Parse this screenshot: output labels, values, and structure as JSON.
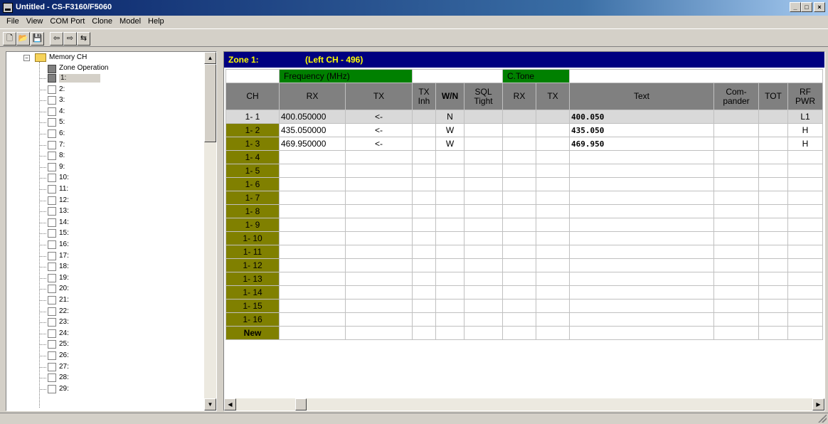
{
  "window": {
    "title": "Untitled - CS-F3160/F5060",
    "min": "_",
    "max": "□",
    "close": "×"
  },
  "menubar": [
    "File",
    "View",
    "COM Port",
    "Clone",
    "Model",
    "Help"
  ],
  "toolbar": [
    {
      "icon": "new-icon",
      "glyph": "🗋"
    },
    {
      "icon": "open-icon",
      "glyph": "📂"
    },
    {
      "icon": "save-icon",
      "glyph": "💾"
    },
    {
      "icon": "read-radio-icon",
      "glyph": "⇦"
    },
    {
      "icon": "write-radio-icon",
      "glyph": "⇨"
    },
    {
      "icon": "clone-icon",
      "glyph": "⇆"
    }
  ],
  "tree": {
    "root": "Memory CH",
    "zone_op": "Zone Operation",
    "items": [
      "1:",
      "2:",
      "3:",
      "4:",
      "5:",
      "6:",
      "7:",
      "8:",
      "9:",
      "10:",
      "11:",
      "12:",
      "13:",
      "14:",
      "15:",
      "16:",
      "17:",
      "18:",
      "19:",
      "20:",
      "21:",
      "22:",
      "23:",
      "24:",
      "25:",
      "26:",
      "27:",
      "28:",
      "29:"
    ]
  },
  "zone": {
    "label": "Zone 1:",
    "left": "(Left CH - 496)"
  },
  "groups": {
    "freq": "Frequency (MHz)",
    "ctone": "C.Tone"
  },
  "headers": {
    "ch": "CH",
    "rx": "RX",
    "tx": "TX",
    "txinh": "TX Inh",
    "wn": "W/N",
    "sql": "SQL Tight",
    "crx": "RX",
    "ctx": "TX",
    "text": "Text",
    "comp": "Com- pander",
    "tot": "TOT",
    "rf": "RF PWR"
  },
  "rows": [
    {
      "ch": "1- 1",
      "rx": "400.050000",
      "tx": "<-",
      "wn": "N",
      "text": "400.050",
      "rf": "L1"
    },
    {
      "ch": "1- 2",
      "rx": "435.050000",
      "tx": "<-",
      "wn": "W",
      "text": "435.050",
      "rf": "H"
    },
    {
      "ch": "1- 3",
      "rx": "469.950000",
      "tx": "<-",
      "wn": "W",
      "text": "469.950",
      "rf": "H"
    },
    {
      "ch": "1- 4"
    },
    {
      "ch": "1- 5"
    },
    {
      "ch": "1- 6"
    },
    {
      "ch": "1- 7"
    },
    {
      "ch": "1- 8"
    },
    {
      "ch": "1- 9"
    },
    {
      "ch": "1- 10"
    },
    {
      "ch": "1- 11"
    },
    {
      "ch": "1- 12"
    },
    {
      "ch": "1- 13"
    },
    {
      "ch": "1- 14"
    },
    {
      "ch": "1- 15"
    },
    {
      "ch": "1- 16"
    },
    {
      "ch": "New"
    }
  ],
  "scroll": {
    "up": "▲",
    "down": "▼",
    "left": "◀",
    "right": "▶"
  }
}
